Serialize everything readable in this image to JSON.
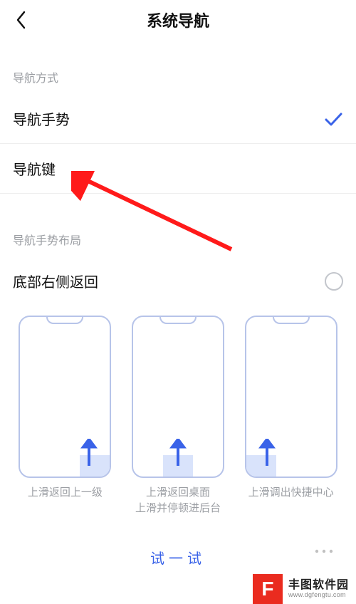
{
  "header": {
    "title": "系统导航"
  },
  "sections": {
    "nav_mode_label": "导航方式",
    "gesture_layout_label": "导航手势布局"
  },
  "options": {
    "gesture": {
      "label": "导航手势",
      "selected": true
    },
    "keys": {
      "label": "导航键",
      "selected": false
    }
  },
  "layout_option": {
    "right_side_back": {
      "label": "底部右侧返回",
      "selected": false
    }
  },
  "cards": [
    {
      "caption": "上滑返回上一级",
      "highlight": "right"
    },
    {
      "caption": "上滑返回桌面\n上滑并停顿进后台",
      "highlight": "center"
    },
    {
      "caption": "上滑调出快捷中心",
      "highlight": "left"
    }
  ],
  "actions": {
    "try": "试一试"
  },
  "watermark": {
    "logo_letter": "F",
    "cn": "丰图软件园",
    "en": "www.dgfengtu.com"
  }
}
